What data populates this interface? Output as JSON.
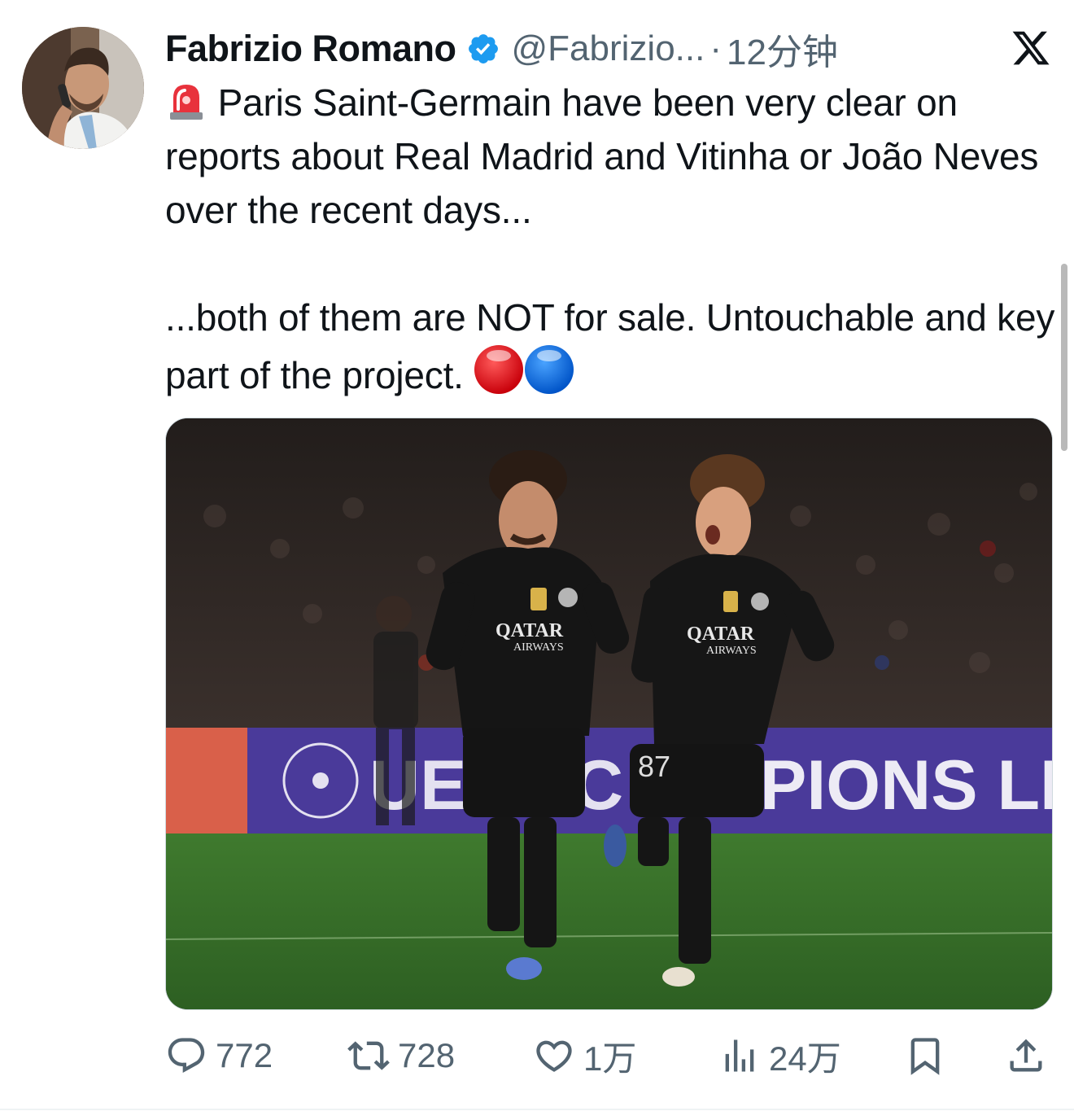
{
  "tweet": {
    "author_name": "Fabrizio Romano",
    "handle": "@Fabrizio...",
    "separator": "·",
    "time": "12分钟",
    "text_line1": " Paris Saint-Germain have been very clear on reports about Real Madrid and Vitinha or João Neves over the recent days...",
    "text_line2": "...both of them are NOT for sale. Untouchable and key part of the project. ",
    "media": {
      "banner_text": "UEFA CHAMPIONS LEAGUE",
      "jersey_sponsor": "QATAR AIRWAYS",
      "sponsor_line1": "QATAR",
      "sponsor_line2": "AIRWAYS",
      "shirt_number": "87",
      "left_banner_text": "UE",
      "mid_banner_text": "C",
      "right_banner_text": "PIONS LEA"
    }
  },
  "actions": {
    "replies": "772",
    "reposts": "728",
    "likes": "1万",
    "views": "24万"
  },
  "icons": {
    "verified": "verified-badge-icon",
    "platform": "x-logo-icon",
    "siren": "rotating-light-emoji",
    "red_circle": "red-circle-emoji",
    "blue_circle": "blue-circle-emoji",
    "reply": "reply-icon",
    "repost": "repost-icon",
    "like": "heart-icon",
    "views": "views-icon",
    "bookmark": "bookmark-icon",
    "share": "share-icon"
  },
  "colors": {
    "verified_blue": "#1d9bf0",
    "text_primary": "#0f1419",
    "text_secondary": "#536471"
  }
}
